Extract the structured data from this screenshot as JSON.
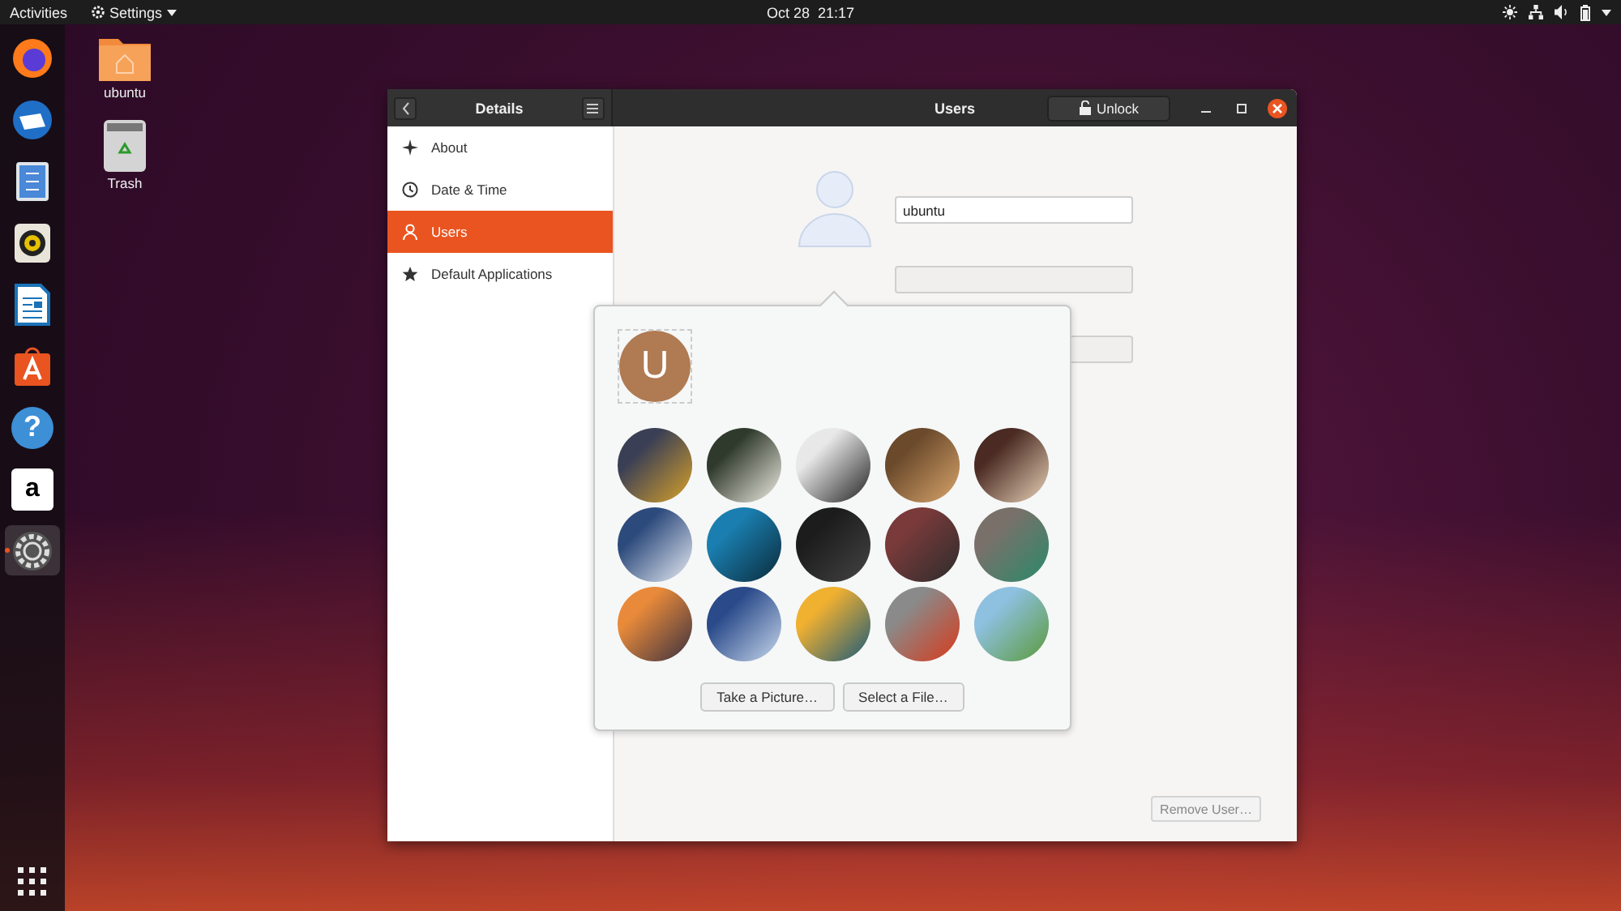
{
  "top_bar": {
    "activities": "Activities",
    "app_menu": "Settings",
    "clock": "Oct 28  21:17"
  },
  "dock": [
    {
      "kind": "browser",
      "selected": false
    },
    {
      "kind": "mail",
      "selected": false
    },
    {
      "kind": "files",
      "selected": false
    },
    {
      "kind": "music",
      "selected": false
    },
    {
      "kind": "writer",
      "selected": false
    },
    {
      "kind": "store",
      "selected": false
    },
    {
      "kind": "help",
      "glyph": "?",
      "selected": false
    },
    {
      "kind": "amazon",
      "glyph": "a",
      "selected": false
    },
    {
      "kind": "settings",
      "selected": true
    }
  ],
  "desktop_icons": [
    {
      "kind": "folder",
      "label": "ubuntu"
    },
    {
      "kind": "trash",
      "label": "Trash"
    }
  ],
  "window": {
    "sidebar_title": "Details",
    "title": "Users",
    "unlock_button": "Unlock",
    "sidebar": [
      {
        "kind": "about",
        "label": "About",
        "selected": false
      },
      {
        "kind": "clock",
        "label": "Date & Time",
        "selected": false
      },
      {
        "kind": "user",
        "label": "Users",
        "selected": true
      },
      {
        "kind": "star",
        "label": "Default Applications",
        "selected": false
      }
    ],
    "user_name": "ubuntu",
    "remove_button": "Remove User…"
  },
  "avatar_popover": {
    "current_initial": "U",
    "buttons": [
      "Take a Picture…",
      "Select a File…"
    ]
  }
}
